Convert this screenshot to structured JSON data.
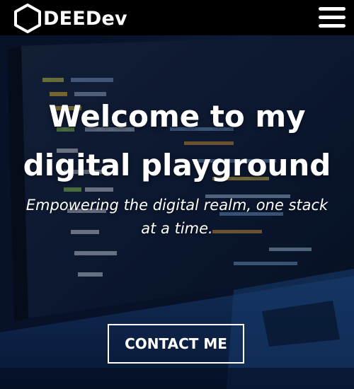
{
  "navbar": {
    "brand_name": "DEEDev",
    "logo_icon": "hexagon-icon",
    "menu_icon": "hamburger-menu-icon"
  },
  "hero": {
    "title": "Welcome to my digital playground",
    "subtitle": "Empowering the digital realm, one stack at a time.",
    "cta_label": "CONTACT ME"
  },
  "colors": {
    "navbar_bg": "#000000",
    "text": "#ffffff",
    "hero_tint": "#0f2c5e"
  }
}
